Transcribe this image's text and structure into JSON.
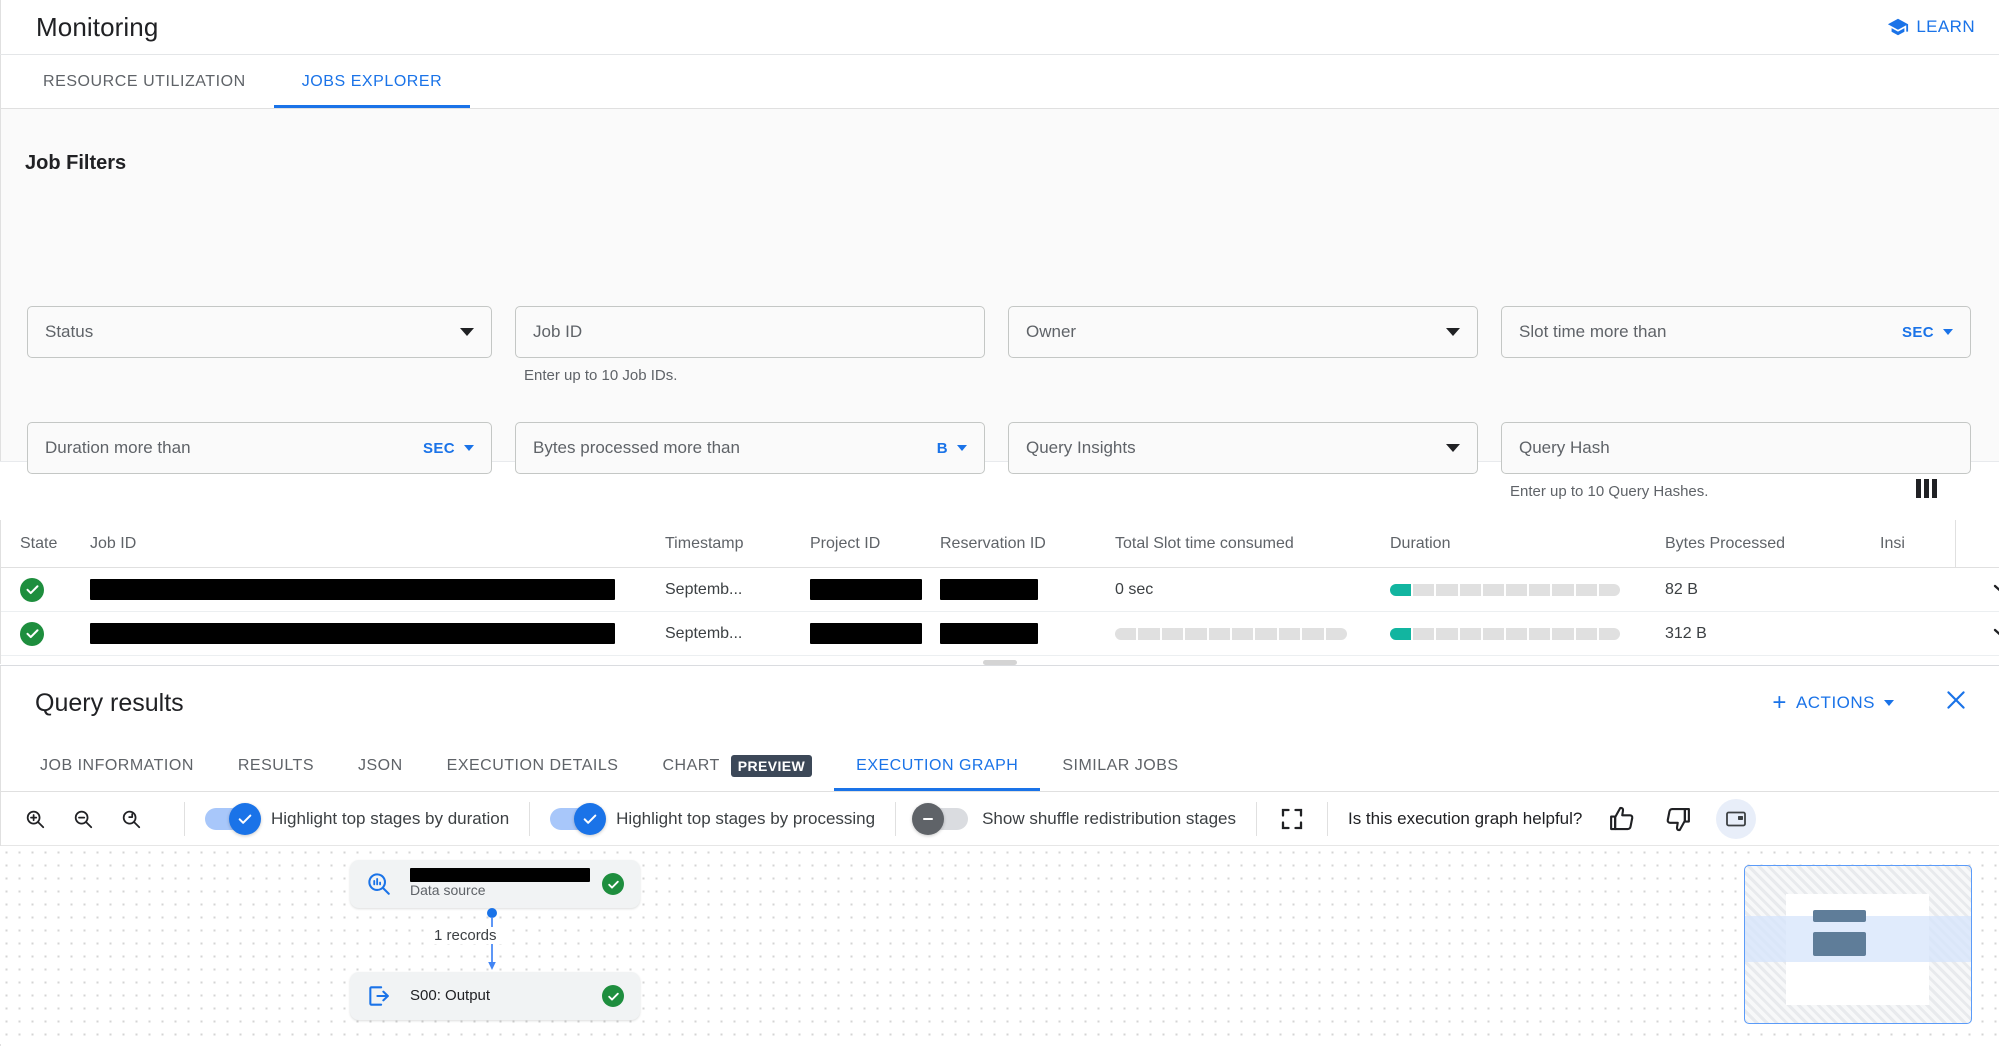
{
  "header": {
    "title": "Monitoring",
    "learn_label": "LEARN",
    "learn_icon": "graduation-cap-icon"
  },
  "tabs": [
    {
      "label": "RESOURCE UTILIZATION",
      "active": false
    },
    {
      "label": "JOBS EXPLORER",
      "active": true
    }
  ],
  "filters": {
    "title": "Job Filters",
    "row1": [
      {
        "name": "status",
        "placeholder": "Status",
        "type": "select",
        "suffix": ""
      },
      {
        "name": "job-id",
        "placeholder": "Job ID",
        "type": "text",
        "suffix": "",
        "hint": "Enter up to 10 Job IDs."
      },
      {
        "name": "owner",
        "placeholder": "Owner",
        "type": "select",
        "suffix": ""
      },
      {
        "name": "slot-time-more-than",
        "placeholder": "Slot time more than",
        "type": "unit",
        "suffix": "SEC"
      }
    ],
    "row2": [
      {
        "name": "duration-more-than",
        "placeholder": "Duration more than",
        "type": "unit",
        "suffix": "SEC"
      },
      {
        "name": "bytes-processed-more-than",
        "placeholder": "Bytes processed more than",
        "type": "unit",
        "suffix": "B"
      },
      {
        "name": "query-insights",
        "placeholder": "Query Insights",
        "type": "select",
        "suffix": ""
      },
      {
        "name": "query-hash",
        "placeholder": "Query Hash",
        "type": "text",
        "suffix": "",
        "hint": "Enter up to 10 Query Hashes."
      }
    ]
  },
  "table": {
    "column_settings_icon": "columns-icon",
    "columns": [
      "State",
      "Job ID",
      "Timestamp",
      "Project ID",
      "Reservation ID",
      "Total Slot time consumed",
      "Duration",
      "Bytes Processed",
      "Insi"
    ],
    "rows": [
      {
        "state": "success",
        "job_id_redacted": true,
        "timestamp": "Septemb...",
        "project_id_redacted": true,
        "reservation_id": "",
        "slot_time": "0 sec",
        "slot_time_bar": null,
        "duration_bar_filled_segments": 1,
        "duration_bar_total_segments": 10,
        "bytes_processed": "82 B",
        "insights": ""
      },
      {
        "state": "success",
        "job_id_redacted": true,
        "timestamp": "Septemb...",
        "project_id_redacted": true,
        "reservation_id": "",
        "slot_time": "",
        "slot_time_bar": {
          "filled_segments": 0,
          "total_segments": 10
        },
        "duration_bar_filled_segments": 1,
        "duration_bar_total_segments": 10,
        "bytes_processed": "312 B",
        "insights": ""
      }
    ]
  },
  "results_panel": {
    "title": "Query results",
    "actions_label": "ACTIONS",
    "close_icon": "close-icon",
    "tabs": [
      {
        "label": "JOB INFORMATION",
        "badge": "",
        "active": false
      },
      {
        "label": "RESULTS",
        "badge": "",
        "active": false
      },
      {
        "label": "JSON",
        "badge": "",
        "active": false
      },
      {
        "label": "EXECUTION DETAILS",
        "badge": "",
        "active": false
      },
      {
        "label": "CHART",
        "badge": "PREVIEW",
        "active": false
      },
      {
        "label": "EXECUTION GRAPH",
        "badge": "",
        "active": true
      },
      {
        "label": "SIMILAR JOBS",
        "badge": "",
        "active": false
      }
    ]
  },
  "graph_toolbar": {
    "zoom_in_icon": "zoom-in-icon",
    "zoom_out_icon": "zoom-out-icon",
    "zoom_reset_icon": "zoom-reset-icon",
    "toggles": [
      {
        "name": "highlight-top-stages-by-duration",
        "label": "Highlight top stages by duration",
        "on": true
      },
      {
        "name": "highlight-top-stages-by-processing",
        "label": "Highlight top stages by processing",
        "on": true
      },
      {
        "name": "show-shuffle-redistribution-stages",
        "label": "Show shuffle redistribution stages",
        "on": false
      }
    ],
    "fullscreen_icon": "fullscreen-icon",
    "feedback_question": "Is this execution graph helpful?",
    "thumb_up_icon": "thumb-up-icon",
    "thumb_down_icon": "thumb-down-icon",
    "side_panel_icon": "side-panel-icon"
  },
  "graph": {
    "nodes": [
      {
        "name": "data-source-node",
        "title": "",
        "title_redacted": true,
        "subtitle": "Data source",
        "icon": "data-source-search-icon",
        "status": "success"
      },
      {
        "name": "output-stage-node",
        "title": "S00: Output",
        "title_redacted": false,
        "subtitle": "",
        "icon": "output-arrow-icon",
        "status": "success"
      }
    ],
    "edges": [
      {
        "label": "1 records"
      }
    ],
    "minimap": {
      "name": "graph-minimap"
    }
  },
  "colors": {
    "accent_blue": "#1a73e8",
    "success_green": "#1e8e3e",
    "bar_teal": "#12b5a0",
    "badge_dark": "#3c4858",
    "filter_bg": "#fafafa"
  }
}
